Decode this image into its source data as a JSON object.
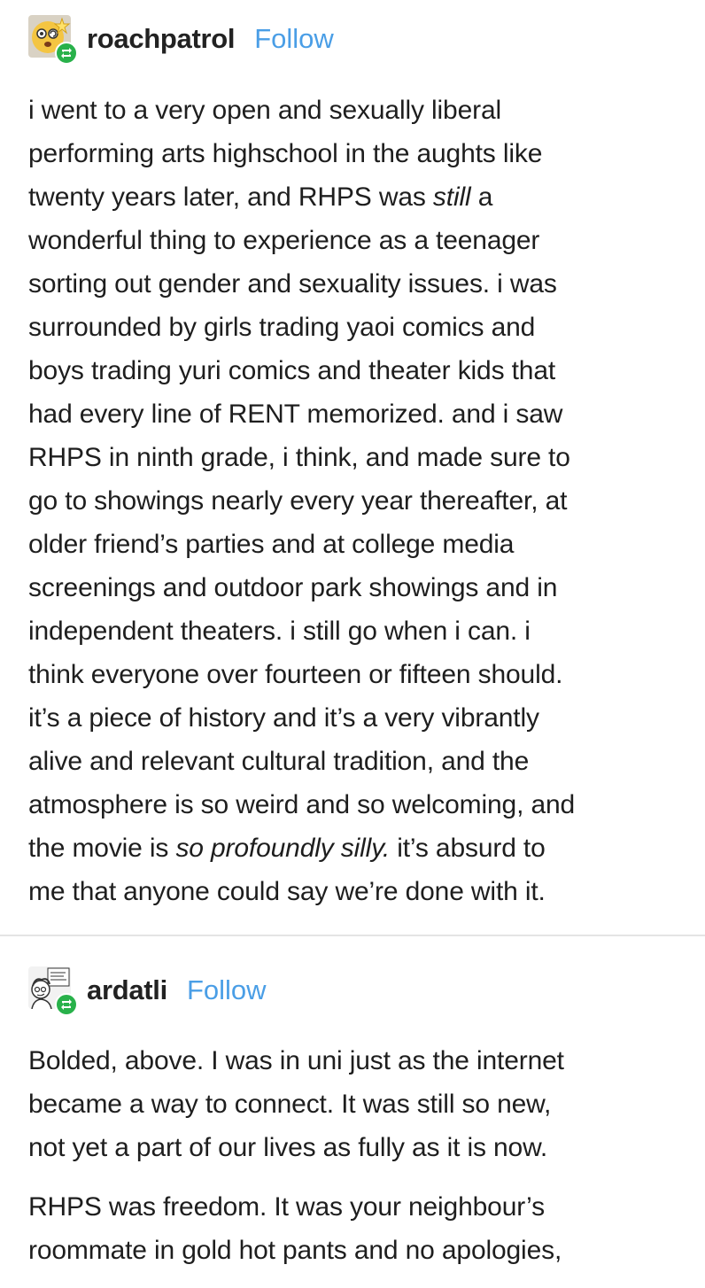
{
  "posts": [
    {
      "username": "roachpatrol",
      "follow_label": "Follow",
      "avatar_icon": "dizzy-star-face-icon",
      "badge_icon": "reblog-icon",
      "body": {
        "lines": [
          "i went to a very open and sexually liberal",
          "performing arts highschool in the aughts like",
          "twenty years later, and RHPS was ",
          "wonderful thing to experience as a teenager",
          "sorting out gender and sexuality issues. i was",
          "surrounded by girls trading yaoi comics and",
          "boys trading yuri comics and theater kids that",
          "had every line of RENT memorized. and i saw",
          "RHPS in ninth grade, i think, and made sure to",
          "go to showings nearly every year thereafter, at",
          "older friend’s parties and at college media",
          "screenings and outdoor park showings and in",
          "independent theaters. i still go when i can. i",
          "think everyone over fourteen or fifteen should.",
          "it’s a piece of history and it’s a very vibrantly",
          "alive and relevant cultural tradition, and the",
          "atmosphere is so weird and so welcoming, and",
          "the movie is ",
          "me that anyone could say we’re done with it."
        ],
        "line3_italic": "still",
        "line3_tail": " a",
        "line18_italic": "so profoundly silly.",
        "line18_tail": " it’s absurd to"
      }
    },
    {
      "username": "ardatli",
      "follow_label": "Follow",
      "avatar_icon": "comic-sketch-avatar-icon",
      "badge_icon": "reblog-icon",
      "paragraphs": [
        {
          "lines": [
            "Bolded, above. I was in uni just as the internet",
            "became a way to connect. It was still so new,",
            "not yet a part of our lives as fully as it is now."
          ]
        },
        {
          "lines": [
            "RHPS was freedom. It was your neighbour’s",
            "roommate in gold hot pants and no apologies,"
          ]
        }
      ]
    }
  ],
  "colors": {
    "follow": "#4a9ee6",
    "reblog_badge": "#28b14a",
    "text": "#1e1e1e",
    "divider": "#e4e4e4"
  }
}
